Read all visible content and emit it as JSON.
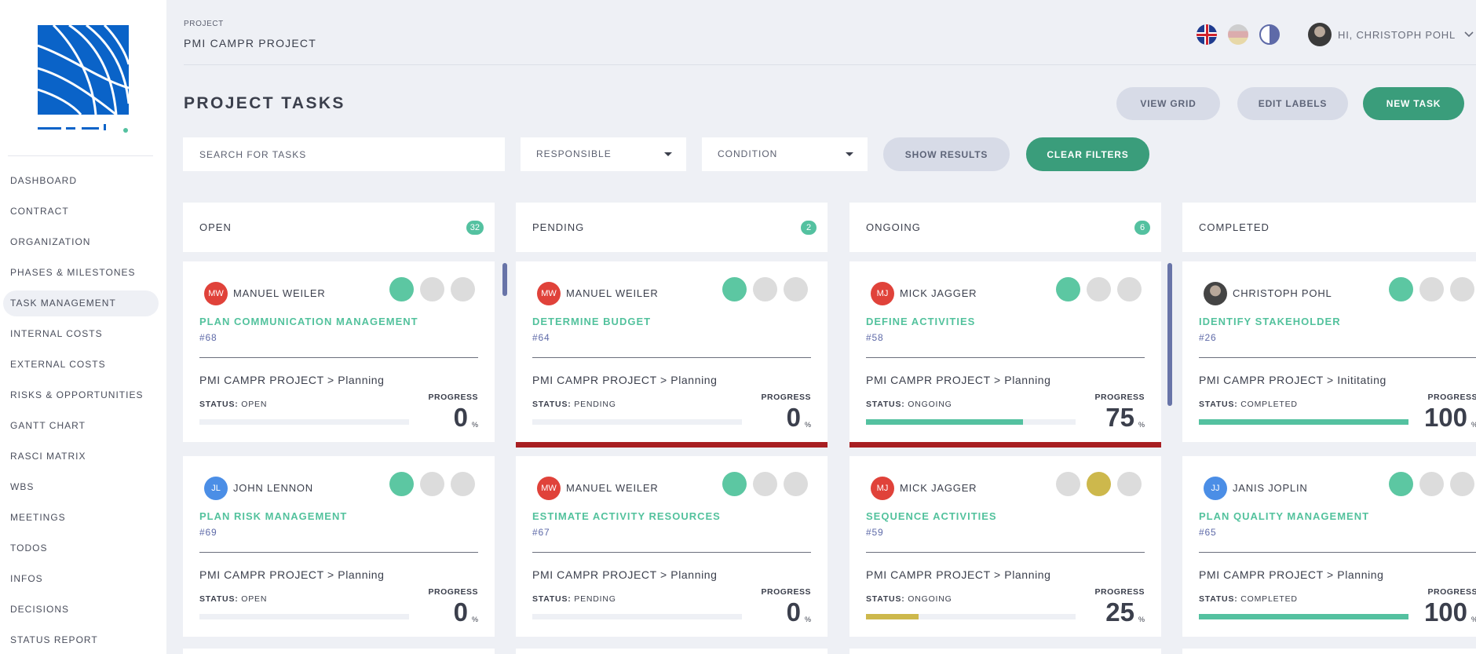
{
  "sidebar": {
    "items": [
      {
        "label": "DASHBOARD"
      },
      {
        "label": "CONTRACT"
      },
      {
        "label": "ORGANIZATION"
      },
      {
        "label": "PHASES & MILESTONES"
      },
      {
        "label": "TASK MANAGEMENT",
        "active": true
      },
      {
        "label": "INTERNAL COSTS"
      },
      {
        "label": "EXTERNAL COSTS"
      },
      {
        "label": "RISKS & OPPORTUNITIES"
      },
      {
        "label": "GANTT CHART"
      },
      {
        "label": "RASCI MATRIX"
      },
      {
        "label": "WBS"
      },
      {
        "label": "MEETINGS"
      },
      {
        "label": "TODOS"
      },
      {
        "label": "INFOS"
      },
      {
        "label": "DECISIONS"
      },
      {
        "label": "STATUS REPORT"
      }
    ]
  },
  "header": {
    "crumb_label": "PROJECT",
    "project_name": "PMI CAMPR PROJECT",
    "user_greeting": "HI, CHRISTOPH POHL"
  },
  "page": {
    "title": "PROJECT TASKS",
    "view_grid": "VIEW GRID",
    "edit_labels": "EDIT LABELS",
    "new_task": "NEW TASK"
  },
  "filters": {
    "search_placeholder": "SEARCH FOR TASKS",
    "responsible": "RESPONSIBLE",
    "condition": "CONDITION",
    "show_results": "SHOW RESULTS",
    "clear_filters": "CLEAR FILTERS"
  },
  "columns": [
    {
      "name": "OPEN",
      "count": "32"
    },
    {
      "name": "PENDING",
      "count": "2"
    },
    {
      "name": "ONGOING",
      "count": "6"
    },
    {
      "name": "COMPLETED",
      "count": ""
    }
  ],
  "common": {
    "status_prefix": "STATUS: ",
    "progress_label": "PROGRESS",
    "percent": "%"
  },
  "cards": [
    {
      "col": 0,
      "row": 0,
      "initials": "MW",
      "avatar": "red",
      "assignee": "MANUEL WEILER",
      "title": "PLAN COMMUNICATION MANAGEMENT",
      "num": "#68",
      "path": "PMI CAMPR PROJECT > Planning",
      "status": "OPEN",
      "progress": "0",
      "dots": [
        "green",
        "grey",
        "grey"
      ]
    },
    {
      "col": 0,
      "row": 1,
      "initials": "JL",
      "avatar": "blue",
      "assignee": "JOHN LENNON",
      "title": "PLAN RISK MANAGEMENT",
      "num": "#69",
      "path": "PMI CAMPR PROJECT > Planning",
      "status": "OPEN",
      "progress": "0",
      "dots": [
        "green",
        "grey",
        "grey"
      ]
    },
    {
      "col": 1,
      "row": 0,
      "initials": "MW",
      "avatar": "red",
      "assignee": "MANUEL WEILER",
      "title": "DETERMINE BUDGET",
      "num": "#64",
      "path": "PMI CAMPR PROJECT > Planning",
      "status": "PENDING",
      "progress": "0",
      "dots": [
        "green",
        "grey",
        "grey"
      ],
      "overdue": true
    },
    {
      "col": 1,
      "row": 1,
      "initials": "MW",
      "avatar": "red",
      "assignee": "MANUEL WEILER",
      "title": "ESTIMATE ACTIVITY RESOURCES",
      "num": "#67",
      "path": "PMI CAMPR PROJECT > Planning",
      "status": "PENDING",
      "progress": "0",
      "dots": [
        "green",
        "grey",
        "grey"
      ]
    },
    {
      "col": 2,
      "row": 0,
      "initials": "MJ",
      "avatar": "red",
      "assignee": "MICK JAGGER",
      "title": "DEFINE ACTIVITIES",
      "num": "#58",
      "path": "PMI CAMPR PROJECT > Planning",
      "status": "ONGOING",
      "progress": "75",
      "bar_color": "green",
      "dots": [
        "green",
        "grey",
        "grey"
      ],
      "overdue": true
    },
    {
      "col": 2,
      "row": 1,
      "initials": "MJ",
      "avatar": "red",
      "assignee": "MICK JAGGER",
      "title": "SEQUENCE ACTIVITIES",
      "num": "#59",
      "path": "PMI CAMPR PROJECT > Planning",
      "status": "ONGOING",
      "progress": "25",
      "bar_color": "yellow",
      "dots": [
        "grey",
        "yellow",
        "grey"
      ]
    },
    {
      "col": 3,
      "row": 0,
      "initials": "",
      "avatar": "photo",
      "assignee": "CHRISTOPH POHL",
      "title": "IDENTIFY STAKEHOLDER",
      "num": "#26",
      "path": "PMI CAMPR PROJECT > Inititating",
      "status": "COMPLETED",
      "progress": "100",
      "bar_color": "green",
      "dots": [
        "green",
        "grey",
        "grey"
      ]
    },
    {
      "col": 3,
      "row": 1,
      "initials": "JJ",
      "avatar": "blue",
      "assignee": "JANIS JOPLIN",
      "title": "PLAN QUALITY MANAGEMENT",
      "num": "#65",
      "path": "PMI CAMPR PROJECT > Planning",
      "status": "COMPLETED",
      "progress": "100",
      "bar_color": "green",
      "dots": [
        "green",
        "grey",
        "grey"
      ]
    }
  ],
  "colors": {
    "accent_green": "#3a9d7b",
    "status_green": "#54c1a0",
    "overdue_red": "#a81f22",
    "logo_blue": "#0a63c8"
  }
}
